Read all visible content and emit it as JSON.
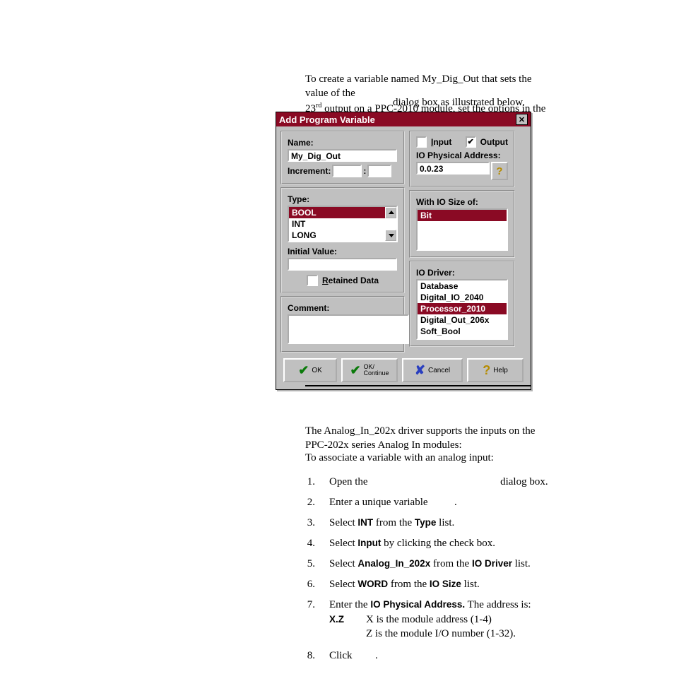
{
  "intro": {
    "line1_prefix": "To create a variable named My_Dig_Out that sets the value of the",
    "line2_pre": "23",
    "line2_sup": "rd",
    "line2_post": " output on a PPC-2010 module, set the options in the",
    "line3": "dialog box as illustrated below."
  },
  "dialog": {
    "title": "Add Program Variable",
    "name_label": "Name:",
    "name_value": "My_Dig_Out",
    "increment_label": "Increment:",
    "type_label": "Type:",
    "type_items": [
      "BOOL",
      "INT",
      "LONG"
    ],
    "type_selected": "BOOL",
    "initial_label": "Initial Value:",
    "retained_label": "Retained Data",
    "comment_label": "Comment:",
    "input_label": "Input",
    "output_label": "Output",
    "output_checked": true,
    "io_addr_label": "IO Physical Address:",
    "io_addr_value": "0.0.23",
    "io_size_label": "With IO Size of:",
    "io_size_selected": "Bit",
    "io_driver_label": "IO Driver:",
    "drivers": [
      "Database",
      "Digital_IO_2040",
      "Processor_2010",
      "Digital_Out_206x",
      "Soft_Bool"
    ],
    "driver_selected": "Processor_2010",
    "buttons": {
      "ok": "OK",
      "ok_continue_top": "OK/",
      "ok_continue_bot": "Continue",
      "cancel": "Cancel",
      "help": "Help"
    }
  },
  "section": {
    "desc": "The Analog_In_202x driver supports the inputs on the PPC-202x series Analog In modules:",
    "assoc": "To associate a variable with an analog input:",
    "steps": {
      "s1_a": "Open the",
      "s1_b": "dialog box.",
      "s2_a": "Enter a unique variable",
      "s2_b": ".",
      "s3_a": "Select ",
      "s3_b": "INT",
      "s3_c": " from the ",
      "s3_d": "Type",
      "s3_e": " list.",
      "s4_a": "Select ",
      "s4_b": "Input",
      "s4_c": " by clicking the check box.",
      "s5_a": "Select ",
      "s5_b": "Analog_In_202x",
      "s5_c": " from the ",
      "s5_d": "IO Driver",
      "s5_e": " list.",
      "s6_a": "Select ",
      "s6_b": "WORD",
      "s6_c": " from the ",
      "s6_d": "IO Size",
      "s6_e": " list.",
      "s7_a": "Enter the ",
      "s7_b": "IO Physical Address.",
      "s7_c": " The address is:",
      "s7_xz": "X.Z",
      "s7_l1": "X is the module address (1-4)",
      "s7_l2": "Z is the module I/O number (1-32).",
      "s8_a": "Click",
      "s8_b": "."
    }
  }
}
